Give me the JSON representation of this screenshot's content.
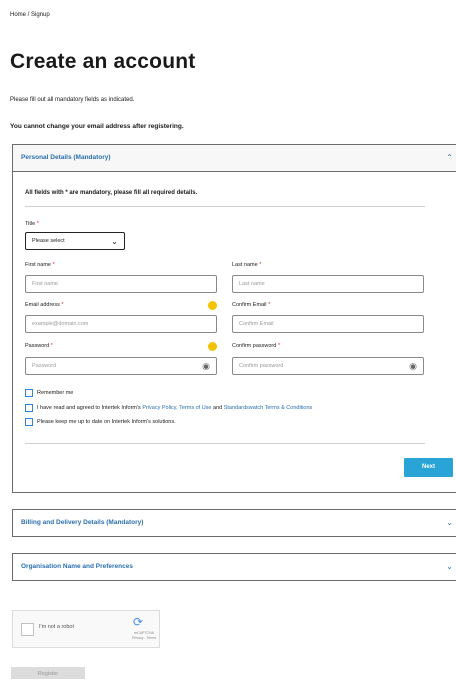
{
  "breadcrumb": "Home / Signup",
  "title": "Create an account",
  "intro_line1": "Please fill out all mandatory fields as indicated.",
  "intro_line2": "You cannot change your email address after registering.",
  "sections": {
    "personal": {
      "label": "Personal Details (Mandatory)",
      "expanded": true
    },
    "billing": {
      "label": "Billing and Delivery Details (Mandatory)",
      "expanded": false
    },
    "organisation": {
      "label": "Organisation Name and Preferences",
      "expanded": false
    }
  },
  "mandatory_note": "All fields with * are mandatory, please fill all required details.",
  "fields": {
    "title": {
      "label": "Title",
      "value": "Please select"
    },
    "first_name": {
      "label": "First name",
      "placeholder": "First name"
    },
    "last_name": {
      "label": "Last name",
      "placeholder": "Last name"
    },
    "email": {
      "label": "Email address",
      "placeholder": "example@domain.com"
    },
    "confirm_email": {
      "label": "Confirm Email",
      "placeholder": "Confirm Email"
    },
    "password": {
      "label": "Password",
      "placeholder": "Password"
    },
    "confirm_password": {
      "label": "Confirm password",
      "placeholder": "Confirm password"
    }
  },
  "required_mark": "*",
  "checkboxes": {
    "remember": "Remember me",
    "terms_prefix": "I have read and agreed to Intertek Inform's ",
    "terms_link1": "Privacy Policy, Terms of Use",
    "terms_and": " and ",
    "terms_link2": "Standardswatch Terms & Conditions",
    "updates": "Please keep me up to date on Intertek Inform's solutions."
  },
  "next_label": "Next",
  "captcha": {
    "label": "I'm not a robot",
    "brand": "reCAPTCHA",
    "links": "Privacy - Terms"
  },
  "register_label": "Register",
  "colors": {
    "accent": "#2aa3d6",
    "link": "#2a6fb1",
    "warning_dot": "#f4c300",
    "required": "#dd2222"
  },
  "icons": {
    "expanded": "chevron-up-icon",
    "collapsed": "chevron-down-icon",
    "password": "eye-icon",
    "info": "warning-dot-icon",
    "captcha": "recaptcha-logo-icon"
  }
}
